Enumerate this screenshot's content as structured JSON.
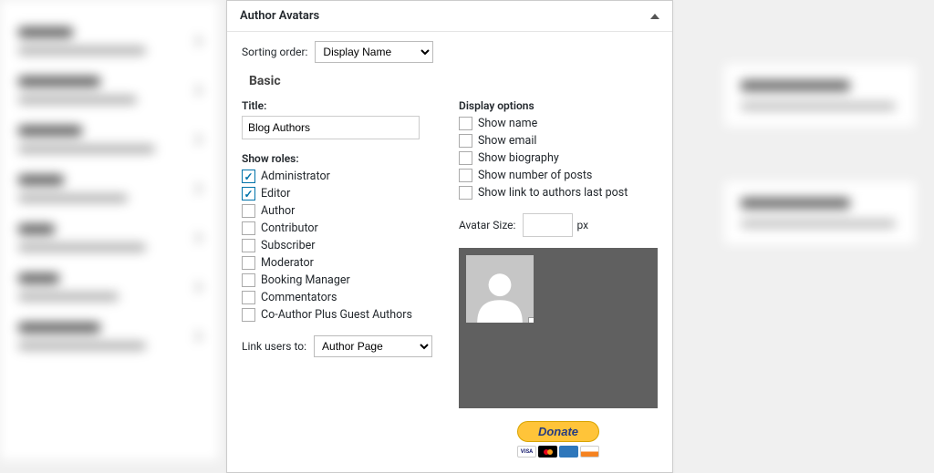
{
  "panel": {
    "title": "Author Avatars",
    "sortingLabel": "Sorting order:",
    "sortingValue": "Display Name",
    "sectionTitle": "Basic",
    "titleLabel": "Title:",
    "titleValue": "Blog Authors",
    "rolesLabel": "Show roles:",
    "roles": [
      {
        "label": "Administrator",
        "checked": true
      },
      {
        "label": "Editor",
        "checked": true
      },
      {
        "label": "Author",
        "checked": false
      },
      {
        "label": "Contributor",
        "checked": false
      },
      {
        "label": "Subscriber",
        "checked": false
      },
      {
        "label": "Moderator",
        "checked": false
      },
      {
        "label": "Booking Manager",
        "checked": false
      },
      {
        "label": "Commentators",
        "checked": false
      },
      {
        "label": "Co-Author Plus Guest Authors",
        "checked": false
      }
    ],
    "linkLabel": "Link users to:",
    "linkValue": "Author Page",
    "displayLabel": "Display options",
    "displayOptions": [
      {
        "label": "Show name",
        "checked": false
      },
      {
        "label": "Show email",
        "checked": false
      },
      {
        "label": "Show biography",
        "checked": false
      },
      {
        "label": "Show number of posts",
        "checked": false
      },
      {
        "label": "Show link to authors last post",
        "checked": false
      }
    ],
    "avatarSizeLabel": "Avatar Size:",
    "avatarSizeUnit": "px",
    "avatarSizeValue": "",
    "donateLabel": "Donate"
  }
}
